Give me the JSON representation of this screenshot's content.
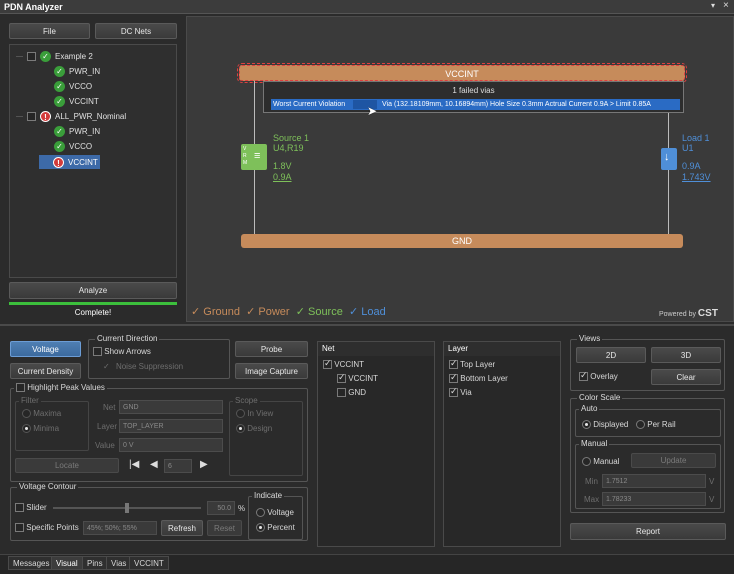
{
  "window": {
    "title": "PDN Analyzer"
  },
  "left": {
    "file_button": "File",
    "dc_nets_button": "DC Nets",
    "tree": [
      {
        "label": "Example 2",
        "kind": "group-ok"
      },
      {
        "label": "PWR_IN",
        "kind": "ok"
      },
      {
        "label": "VCCO",
        "kind": "ok"
      },
      {
        "label": "VCCINT",
        "kind": "ok"
      },
      {
        "label": "ALL_PWR_Nominal",
        "kind": "group-err"
      },
      {
        "label": "PWR_IN",
        "kind": "ok"
      },
      {
        "label": "VCCO",
        "kind": "ok"
      },
      {
        "label": "VCCINT",
        "kind": "err-selected"
      }
    ],
    "analyze_button": "Analyze",
    "status": "Complete!",
    "progress": 1.0
  },
  "canvas": {
    "rail_top": "VCCINT",
    "rail_bottom": "GND",
    "tooltip": {
      "title": "1 failed vias",
      "label": "Worst Current Violation",
      "text": "Via (132.18109mm, 10.16894mm) Hole Size 0.3mm Actrual Current 0.9A >  Limit 0.85A"
    },
    "source": {
      "name": "Source 1",
      "ref": "U4,R19",
      "voltage": "1.8V",
      "current": "0.9A",
      "badge": "VRM"
    },
    "load": {
      "name": "Load 1",
      "ref": "U1",
      "current": "0.9A",
      "voltage": "1.743V"
    },
    "legend": [
      {
        "label": "Ground",
        "color": "#c8905e"
      },
      {
        "label": "Power",
        "color": "#c8905e"
      },
      {
        "label": "Source",
        "color": "#7ec05a"
      },
      {
        "label": "Load",
        "color": "#4f8fd8"
      }
    ],
    "powered_by": "Powered by",
    "brand": "CST"
  },
  "controls": {
    "voltage_button": "Voltage",
    "current_density_button": "Current Density",
    "current_direction": {
      "title": "Current Direction",
      "show_arrows": "Show Arrows",
      "noise_suppression": "Noise Suppression"
    },
    "probe_button": "Probe",
    "image_capture_button": "Image Capture",
    "highlight_peak": "Highlight Peak Values",
    "filter": {
      "title": "Filter",
      "maxima": "Maxima",
      "minima": "Minima"
    },
    "net_label": "Net",
    "net_value": "GND",
    "layer_label": "Layer",
    "layer_value": "TOP_LAYER",
    "value_label": "Value",
    "value_value": "0 V",
    "scope": {
      "title": "Scope",
      "in_view": "In View",
      "design": "Design"
    },
    "locate_button": "Locate",
    "nav_index": "6",
    "voltage_contour": {
      "title": "Voltage Contour",
      "slider": "Slider",
      "slider_value": "50.0",
      "percent_sign": "%",
      "specific_points": "Specific Points",
      "points_value": "45%; 50%; 55%",
      "refresh": "Refresh",
      "reset": "Reset"
    },
    "indicate": {
      "title": "Indicate",
      "voltage": "Voltage",
      "percent": "Percent"
    }
  },
  "net_panel": {
    "header": "Net",
    "items": [
      {
        "label": "VCCINT",
        "checked": true,
        "indent": 0
      },
      {
        "label": "VCCINT",
        "checked": true,
        "indent": 1
      },
      {
        "label": "GND",
        "checked": false,
        "indent": 1
      }
    ]
  },
  "layer_panel": {
    "header": "Layer",
    "items": [
      {
        "label": "Top Layer",
        "checked": true
      },
      {
        "label": "Bottom Layer",
        "checked": true
      },
      {
        "label": "Via",
        "checked": true
      }
    ]
  },
  "views": {
    "title": "Views",
    "btn_2d": "2D",
    "btn_3d": "3D",
    "overlay": "Overlay",
    "clear": "Clear"
  },
  "color_scale": {
    "title": "Color Scale",
    "auto": "Auto",
    "displayed": "Displayed",
    "per_rail": "Per Rail",
    "manual_group": "Manual",
    "manual": "Manual",
    "update": "Update",
    "min_label": "Min",
    "min_value": "1.7512",
    "min_unit": "V",
    "max_label": "Max",
    "max_value": "1.78233",
    "max_unit": "V"
  },
  "report_button": "Report",
  "tabs": [
    "Messages",
    "Visual",
    "Pins",
    "Vias",
    "VCCINT"
  ],
  "selected_tab": "Visual"
}
